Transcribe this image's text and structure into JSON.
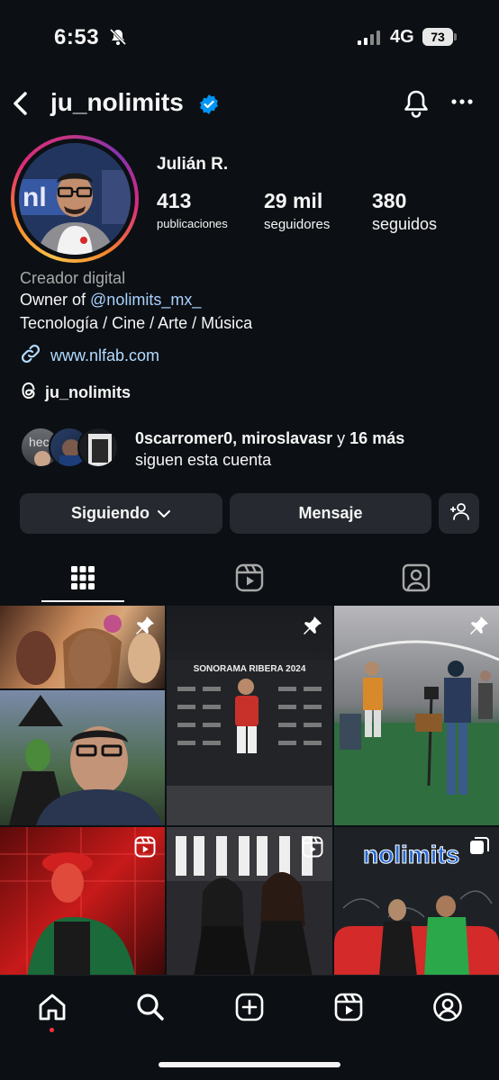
{
  "status_bar": {
    "time": "6:53",
    "network": "4G",
    "battery": "73"
  },
  "header": {
    "username": "ju_nolimits"
  },
  "profile": {
    "display_name": "Julián R.",
    "stats": [
      {
        "value": "413",
        "label": "publicaciones"
      },
      {
        "value": "29 mil",
        "label": "seguidores"
      },
      {
        "value": "380",
        "label": "seguidos"
      }
    ],
    "category": "Creador digital",
    "bio_owner_prefix": "Owner of ",
    "bio_mention": "@nolimits_mx_",
    "bio_interests": "Tecnología / Cine / Arte / Música",
    "link": "www.nlfab.com",
    "threads_handle": "ju_nolimits",
    "followed_by_names": "0scarromer0, miroslavasr",
    "followed_by_connector": " y ",
    "followed_by_more": "16 más",
    "followed_by_suffix": "siguen esta cuenta"
  },
  "actions": {
    "following": "Siguiendo",
    "message": "Mensaje"
  },
  "posts": {
    "cell_2_title": "SONORAMA RIBERA 2024",
    "cell_6_sign": "nolimits"
  },
  "icons": {
    "status": [
      "bell-slash-icon",
      "signal-icon",
      "battery-icon"
    ],
    "header": [
      "back-icon",
      "verified-icon",
      "bell-icon",
      "more-icon"
    ],
    "profile": [
      "link-icon",
      "threads-icon"
    ],
    "actions": [
      "chevron-down-icon",
      "add-person-icon"
    ],
    "tabs": [
      "grid-icon",
      "reels-icon",
      "tagged-icon"
    ],
    "posts": [
      "pin-icon",
      "reel-icon",
      "carousel-icon"
    ],
    "bottom_nav": [
      "home-icon",
      "search-icon",
      "create-icon",
      "reels-icon",
      "profile-icon"
    ]
  },
  "colors": {
    "background": "#0c1014",
    "button": "#262a30",
    "verified": "#0095f6",
    "link": "#b3dbff",
    "notification_dot": "#ff3040"
  }
}
